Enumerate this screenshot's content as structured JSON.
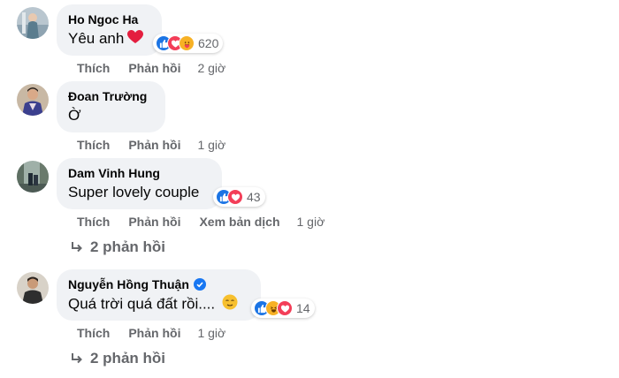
{
  "colors": {
    "like": "#1b74e4",
    "love": "#f33e58",
    "care": "#f7b125",
    "haha": "#f7b125",
    "verified": "#1877f2",
    "bubble": "#f0f2f5",
    "meta": "#65676b"
  },
  "comments": [
    {
      "author": "Ho Ngoc Ha",
      "text": "Yêu anh",
      "text_emoji": "heart",
      "reactions": [
        "like",
        "love",
        "care"
      ],
      "reaction_count": "620",
      "actions": {
        "like": "Thích",
        "reply": "Phản hồi"
      },
      "time": "2 giờ"
    },
    {
      "author": "Đoan Trường",
      "text": "Ờ",
      "actions": {
        "like": "Thích",
        "reply": "Phản hồi"
      },
      "time": "1 giờ"
    },
    {
      "author": "Dam Vinh Hung",
      "text": "Super lovely couple",
      "reactions": [
        "like",
        "love"
      ],
      "reaction_count": "43",
      "actions": {
        "like": "Thích",
        "reply": "Phản hồi",
        "translate": "Xem bản dịch"
      },
      "time": "1 giờ",
      "replies": "2 phản hồi"
    },
    {
      "author": "Nguyễn Hồng Thuận",
      "verified": true,
      "text": "Quá trời quá đất rồi....",
      "text_emoji": "relieved-face",
      "reactions": [
        "like",
        "haha",
        "love"
      ],
      "reaction_count": "14",
      "actions": {
        "like": "Thích",
        "reply": "Phản hồi"
      },
      "time": "1 giờ",
      "replies": "2 phản hồi"
    }
  ]
}
